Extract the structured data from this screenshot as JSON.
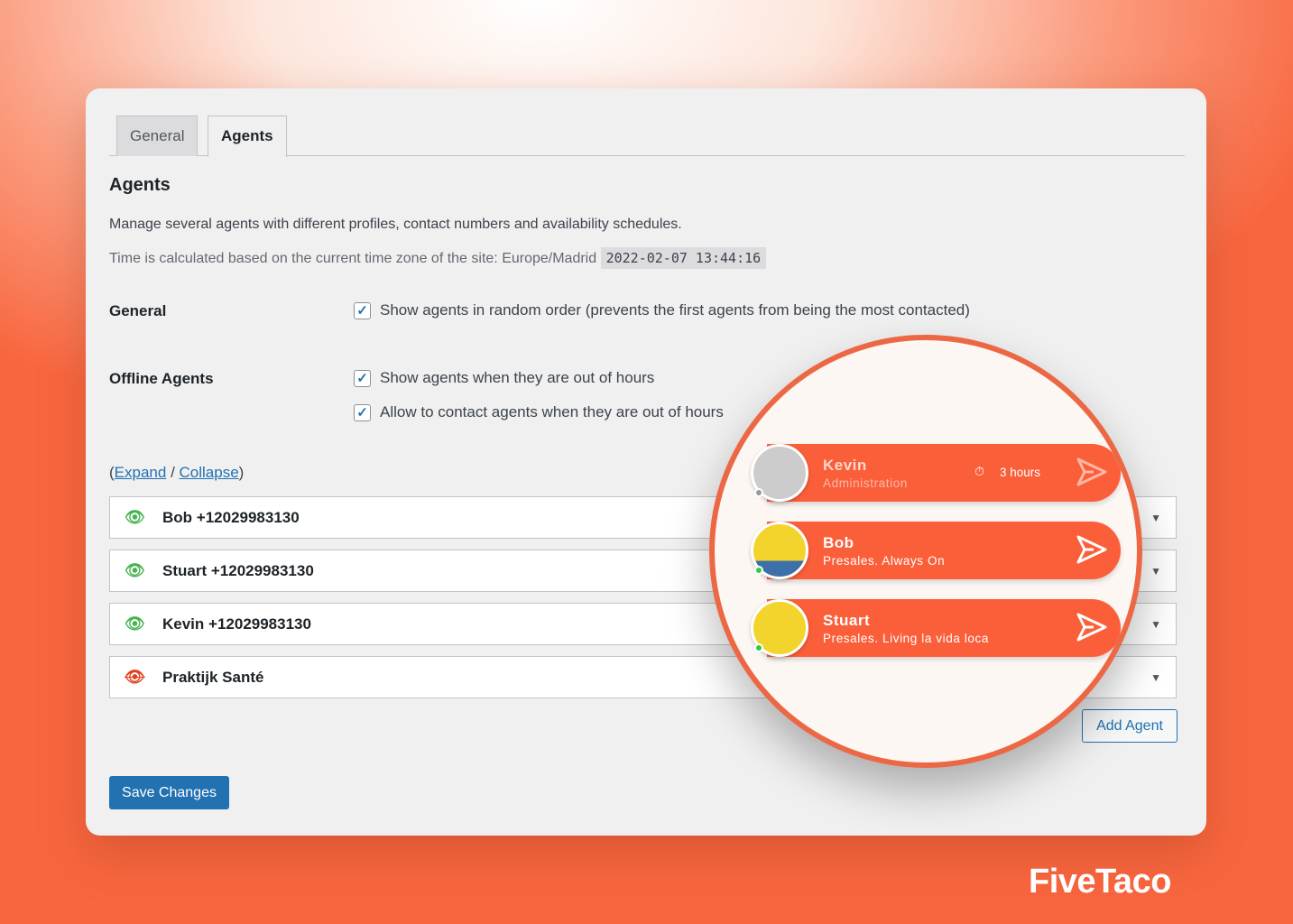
{
  "tabs": [
    {
      "label": "General",
      "active": false
    },
    {
      "label": "Agents",
      "active": true
    }
  ],
  "section": {
    "title": "Agents",
    "description": "Manage several agents with different profiles, contact numbers and availability schedules.",
    "timezone_text": "Time is calculated based on the current time zone of the site: Europe/Madrid",
    "current_time": "2022-02-07 13:44:16"
  },
  "general": {
    "label": "General",
    "random_order": {
      "label": "Show agents in random order (prevents the first agents from being the most contacted)",
      "checked": true
    }
  },
  "offline": {
    "label": "Offline Agents",
    "show": {
      "label": "Show agents when they are out of hours",
      "checked": true
    },
    "allow": {
      "label": "Allow to contact agents when they are out of hours",
      "checked": true
    }
  },
  "links": {
    "open": "(",
    "expand": "Expand",
    "sep": " / ",
    "collapse": "Collapse",
    "close": ")"
  },
  "agents": [
    {
      "name": "Bob",
      "phone": "+12029983130",
      "visible": true
    },
    {
      "name": "Stuart",
      "phone": "+12029983130",
      "visible": true
    },
    {
      "name": "Kevin",
      "phone": "+12029983130",
      "visible": true
    },
    {
      "name": "Praktijk Santé",
      "phone": "",
      "visible": false
    }
  ],
  "add_agent": "Add Agent",
  "save": "Save Changes",
  "preview": [
    {
      "name": "Kevin",
      "subtitle": "Administration",
      "status": "offline",
      "time_label": "3 hours"
    },
    {
      "name": "Bob",
      "subtitle": "Presales. Always On",
      "status": "online"
    },
    {
      "name": "Stuart",
      "subtitle": "Presales. Living la vida loca",
      "status": "online"
    }
  ],
  "brand": "FiveTaco",
  "colors": {
    "accent": "#fb5f3a",
    "wp_blue": "#2271b1",
    "online": "#2ecc40",
    "offline": "#999999",
    "eye_on": "#46b450",
    "eye_off": "#e2401c"
  }
}
